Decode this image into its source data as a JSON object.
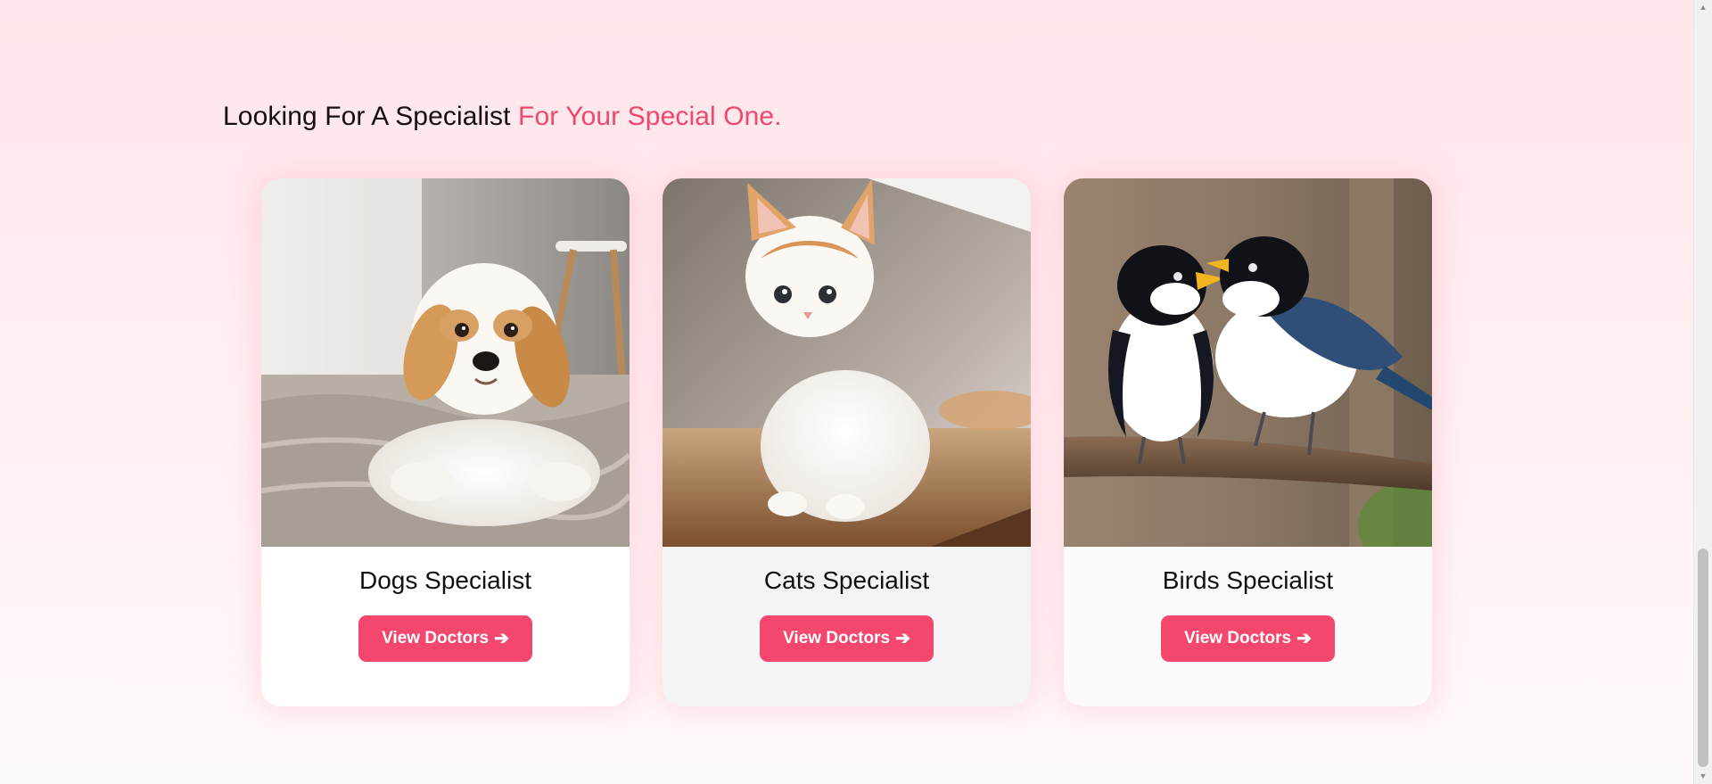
{
  "section": {
    "heading_main": "Looking For A Specialist ",
    "heading_accent": "For Your Special One."
  },
  "cards": [
    {
      "title": "Dogs Specialist",
      "button_label": "View Doctors",
      "button_icon": "arrow-right-icon",
      "image": "puppy-photo"
    },
    {
      "title": "Cats Specialist",
      "button_label": "View Doctors",
      "button_icon": "arrow-right-icon",
      "image": "kitten-photo"
    },
    {
      "title": "Birds Specialist",
      "button_label": "View Doctors",
      "button_icon": "arrow-right-icon",
      "image": "birds-photo"
    }
  ],
  "colors": {
    "accent": "#f0476b",
    "button": "#f4476d",
    "background_top": "#ffe6ea",
    "background_bottom": "#fffafa"
  }
}
